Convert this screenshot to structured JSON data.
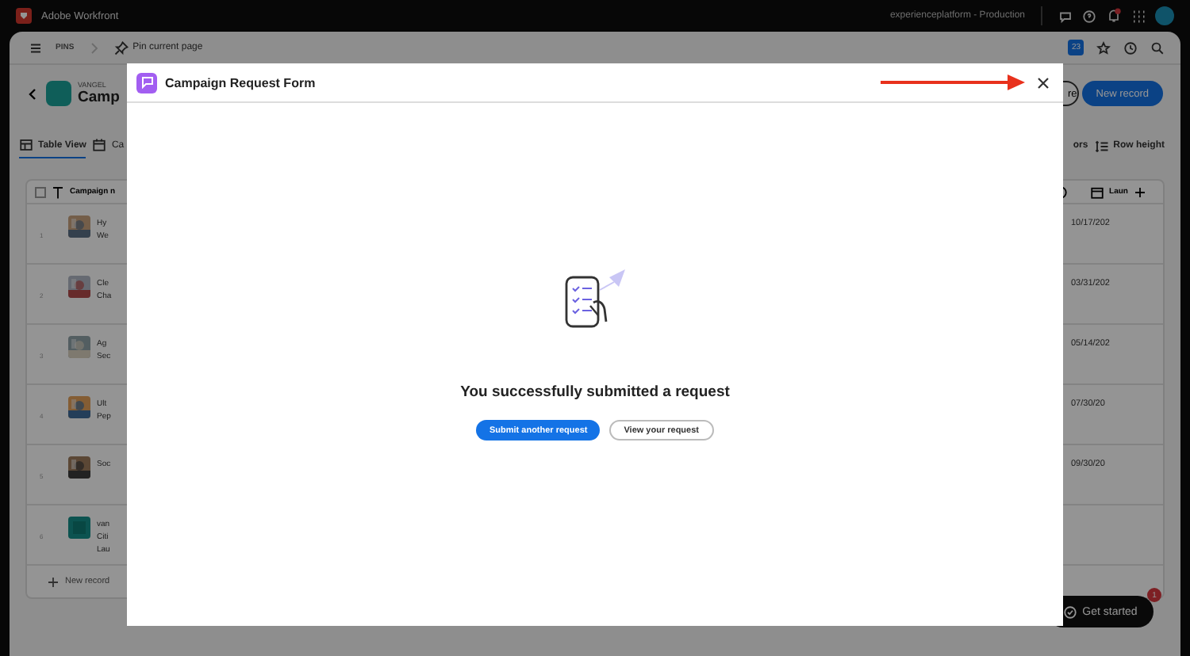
{
  "app_bar": {
    "product": "Adobe Workfront",
    "environment": "experienceplatform - Production"
  },
  "nav_bar": {
    "pins_label": "PINS",
    "pin_action": "Pin current page",
    "calendar_badge": "23"
  },
  "header": {
    "eyebrow": "VANGEL",
    "title": "Camp",
    "secondary_button": "re",
    "primary_button": "New record"
  },
  "views": {
    "tabs": [
      {
        "label": "Table View",
        "selected": true
      },
      {
        "label": "Ca",
        "selected": false
      }
    ],
    "right_actions": [
      "ors",
      "Row height"
    ]
  },
  "table": {
    "select_all": {
      "checked": false
    },
    "first_column": "Campaign n",
    "last_column": "Laun",
    "rows": [
      {
        "number": "1",
        "lines": [
          "Hy",
          "We"
        ],
        "date": "10/17/202"
      },
      {
        "number": "2",
        "lines": [
          "Cle",
          "Cha"
        ],
        "date": "03/31/202"
      },
      {
        "number": "3",
        "lines": [
          "Ag",
          "Sec"
        ],
        "date": "05/14/202"
      },
      {
        "number": "4",
        "lines": [
          "Ult",
          "Pep"
        ],
        "date": "07/30/20"
      },
      {
        "number": "5",
        "lines": [
          "Soc"
        ],
        "date": "09/30/20"
      },
      {
        "number": "6",
        "lines": [
          "van",
          "Citi",
          "Lau"
        ]
      }
    ],
    "add_row": "New record"
  },
  "help": {
    "label": "Get started",
    "badge": "1"
  },
  "modal": {
    "title": "Campaign Request Form",
    "message": "You successfully submitted a request",
    "buttons": [
      {
        "label": "Submit another request",
        "kind": "primary"
      },
      {
        "label": "View your request",
        "kind": "secondary"
      }
    ]
  }
}
